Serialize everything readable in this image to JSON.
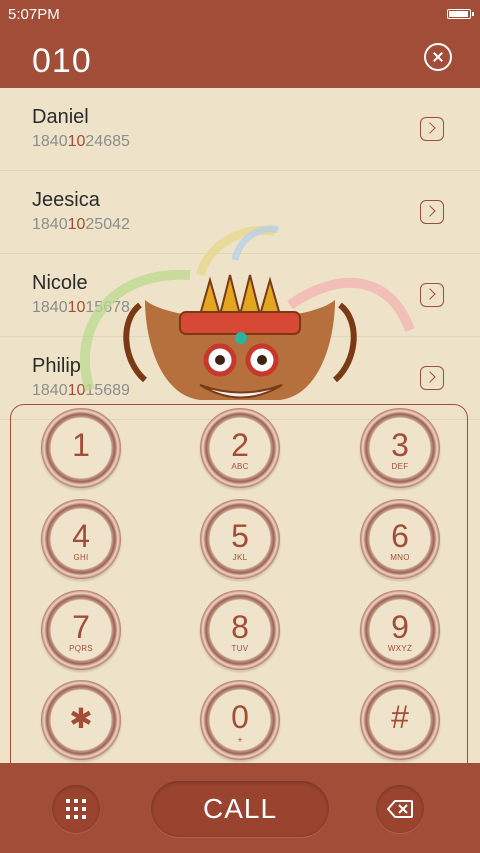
{
  "status": {
    "time": "5:07PM",
    "battery_level": 0.95
  },
  "header": {
    "number": "010",
    "clear_icon": "close-circle-icon"
  },
  "contacts": [
    {
      "name": "Daniel",
      "phone_pre": "1840",
      "phone_match": "10",
      "phone_post": "24685"
    },
    {
      "name": "Jeesica",
      "phone_pre": "1840",
      "phone_match": "10",
      "phone_post": "25042"
    },
    {
      "name": "Nicole",
      "phone_pre": "1840",
      "phone_match": "10",
      "phone_post": "15678"
    },
    {
      "name": "Philip",
      "phone_pre": "1840",
      "phone_match": "10",
      "phone_post": "15689"
    }
  ],
  "keypad": [
    {
      "digit": "1",
      "letters": ""
    },
    {
      "digit": "2",
      "letters": "ABC"
    },
    {
      "digit": "3",
      "letters": "DEF"
    },
    {
      "digit": "4",
      "letters": "GHI"
    },
    {
      "digit": "5",
      "letters": "JKL"
    },
    {
      "digit": "6",
      "letters": "MNO"
    },
    {
      "digit": "7",
      "letters": "PQRS"
    },
    {
      "digit": "8",
      "letters": "TUV"
    },
    {
      "digit": "9",
      "letters": "WXYZ"
    },
    {
      "digit": "✱",
      "letters": ""
    },
    {
      "digit": "0",
      "letters": "+"
    },
    {
      "digit": "#",
      "letters": ""
    }
  ],
  "bottom": {
    "call_label": "CALL",
    "dialpad_icon": "dialpad-grid-icon",
    "backspace_icon": "backspace-icon"
  },
  "colors": {
    "primary": "#a14d37",
    "background": "#eee3c8",
    "match_highlight": "#a14d37"
  }
}
